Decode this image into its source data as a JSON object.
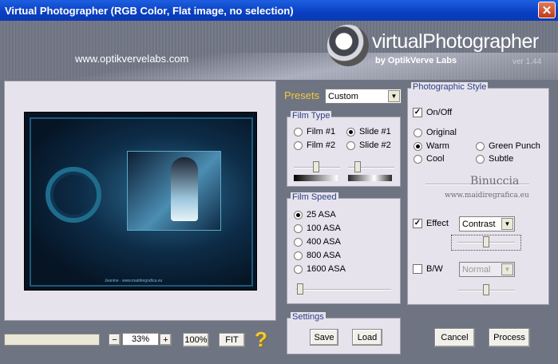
{
  "window": {
    "title": "Virtual Photographer (RGB Color, Flat image, no selection)",
    "close": "✕"
  },
  "header": {
    "site": "www.optikvervelabs.com",
    "brand": "virtualPhotographer",
    "byline": "by OptikVerve Labs",
    "version": "ver 1.44"
  },
  "preview": {
    "caption": "Jeanine · www.maidiregrafica.eu"
  },
  "zoom": {
    "minus": "−",
    "value": "33%",
    "plus": "+",
    "hundred": "100%",
    "fit": "FIT",
    "help": "?"
  },
  "presets": {
    "label": "Presets",
    "value": "Custom"
  },
  "film_type": {
    "title": "Film Type",
    "options": [
      "Film #1",
      "Slide #1",
      "Film #2",
      "Slide #2"
    ],
    "selected": "Slide #1"
  },
  "film_speed": {
    "title": "Film Speed",
    "options": [
      "25 ASA",
      "100 ASA",
      "400 ASA",
      "800 ASA",
      "1600 ASA"
    ],
    "selected": "25 ASA"
  },
  "settings": {
    "title": "Settings",
    "save": "Save",
    "load": "Load"
  },
  "photographic_style": {
    "title": "Photographic Style",
    "onoff": "On/Off",
    "styles": [
      "Original",
      "Warm",
      "Green Punch",
      "Cool",
      "Subtle"
    ],
    "selected": "Warm",
    "watermark_name": "Binuccia",
    "watermark_site": "www.maidiregrafica.eu",
    "effect_label": "Effect",
    "effect_value": "Contrast",
    "bw_label": "B/W",
    "bw_value": "Normal"
  },
  "actions": {
    "cancel": "Cancel",
    "process": "Process"
  }
}
